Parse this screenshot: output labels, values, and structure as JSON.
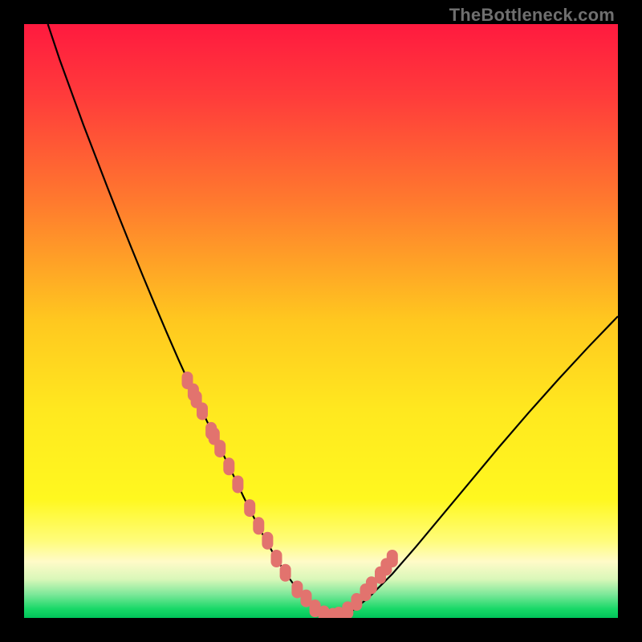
{
  "watermark": "TheBottleneck.com",
  "colors": {
    "frame": "#000000",
    "curve": "#000000",
    "marker": "#e2736e",
    "gradient_stops": [
      {
        "offset": 0.0,
        "color": "#ff1a3f"
      },
      {
        "offset": 0.12,
        "color": "#ff3b3b"
      },
      {
        "offset": 0.3,
        "color": "#ff7a2e"
      },
      {
        "offset": 0.5,
        "color": "#ffc81f"
      },
      {
        "offset": 0.65,
        "color": "#ffe81f"
      },
      {
        "offset": 0.8,
        "color": "#fff81f"
      },
      {
        "offset": 0.87,
        "color": "#fffc7a"
      },
      {
        "offset": 0.905,
        "color": "#fffbc8"
      },
      {
        "offset": 0.935,
        "color": "#d9f7b9"
      },
      {
        "offset": 0.96,
        "color": "#7ee89a"
      },
      {
        "offset": 0.985,
        "color": "#18d867"
      },
      {
        "offset": 1.0,
        "color": "#00c45a"
      }
    ]
  },
  "chart_data": {
    "type": "line",
    "title": "",
    "xlabel": "",
    "ylabel": "",
    "xlim": [
      0,
      100
    ],
    "ylim": [
      0,
      100
    ],
    "series": [
      {
        "name": "bottleneck-curve",
        "x": [
          4,
          6,
          8,
          10,
          12,
          14,
          16,
          18,
          20,
          22,
          24,
          26,
          28,
          30,
          32,
          33.8,
          35.5,
          37,
          38.5,
          40,
          42,
          44,
          46,
          48,
          50,
          52,
          55,
          58,
          62,
          66,
          70,
          75,
          80,
          85,
          90,
          95,
          100
        ],
        "y": [
          100,
          94,
          88.5,
          83,
          77.8,
          72.6,
          67.5,
          62.5,
          57.6,
          52.8,
          48.1,
          43.5,
          39.1,
          34.8,
          30.6,
          27.0,
          23.5,
          20.3,
          17.3,
          14.4,
          10.8,
          7.6,
          4.8,
          2.6,
          1.0,
          0.2,
          1.0,
          3.4,
          7.4,
          12.0,
          16.8,
          22.8,
          28.8,
          34.6,
          40.2,
          45.6,
          50.8
        ]
      }
    ],
    "markers": {
      "name": "highlighted-points",
      "x": [
        27.5,
        28.5,
        29.0,
        30.0,
        31.5,
        32.0,
        33.0,
        34.5,
        36.0,
        38.0,
        39.5,
        41.0,
        42.5,
        44.0,
        46.0,
        47.5,
        49.0,
        50.5,
        52.0,
        53.0,
        54.5,
        56.0,
        57.5,
        58.5,
        60.0,
        61.0,
        62.0
      ],
      "y": [
        40.0,
        38.0,
        36.8,
        34.8,
        31.5,
        30.6,
        28.5,
        25.5,
        22.5,
        18.5,
        15.5,
        13.0,
        10.0,
        7.6,
        4.8,
        3.3,
        1.6,
        0.6,
        0.2,
        0.4,
        1.3,
        2.7,
        4.3,
        5.5,
        7.2,
        8.6,
        10.0
      ]
    }
  }
}
